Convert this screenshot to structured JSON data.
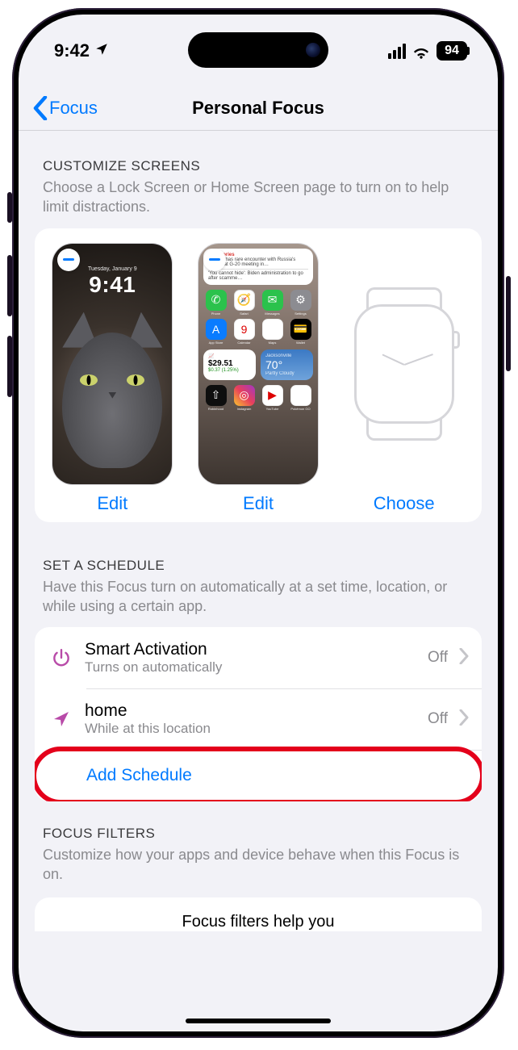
{
  "status": {
    "time": "9:42",
    "battery": "94"
  },
  "nav": {
    "back": "Focus",
    "title": "Personal Focus"
  },
  "customize": {
    "header": "CUSTOMIZE SCREENS",
    "desc": "Choose a Lock Screen or Home Screen page to turn on to help limit distractions.",
    "lock": {
      "action": "Edit",
      "clock_time": "9:41",
      "clock_date": "Tuesday, January 9"
    },
    "home": {
      "action": "Edit",
      "news_header": "Top Stories",
      "news_line1": "Blinken has rare encounter with Russia's Lavrov at G-20 meeting in…",
      "news_line2": "'You cannot hide': Biden administration to go after scamme…",
      "weather_city": "Jacksonville",
      "weather_temp": "70°",
      "weather_cond": "Partly Cloudy",
      "stocks_price": "$29.51",
      "stocks_change": "$0.37 (1.25%)",
      "apps": [
        "Phone",
        "Safari",
        "Messages",
        "Settings",
        "App Store",
        "Calendar",
        "Maps",
        "Wallet",
        "Robinhood",
        "Instagram",
        "YouTube",
        "Pokémon GO"
      ]
    },
    "watch": {
      "action": "Choose"
    }
  },
  "schedule": {
    "header": "SET A SCHEDULE",
    "desc": "Have this Focus turn on automatically at a set time, location, or while using a certain app.",
    "items": [
      {
        "title": "Smart Activation",
        "sub": "Turns on automatically",
        "status": "Off"
      },
      {
        "title": "home",
        "sub": "While at this location",
        "status": "Off"
      }
    ],
    "add": "Add Schedule"
  },
  "filters": {
    "header": "FOCUS FILTERS",
    "desc": "Customize how your apps and device behave when this Focus is on.",
    "peek": "Focus filters help you"
  }
}
